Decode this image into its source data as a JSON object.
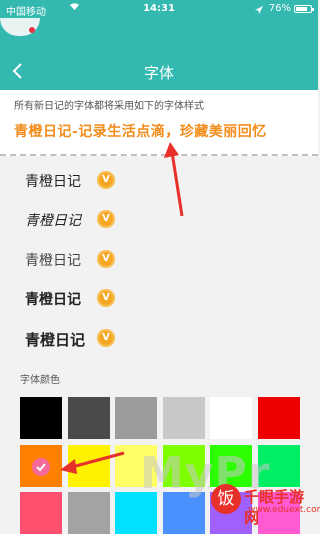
{
  "status_bar": {
    "carrier": "中国移动",
    "wifi_icon": "wifi-icon",
    "time": "14:31",
    "battery": "76%",
    "battery_level": 0.76
  },
  "header": {
    "title": "字体",
    "back_icon": "chevron-left-icon"
  },
  "preview": {
    "hint": "所有新日记的字体都将采用如下的字体样式",
    "sample": "青橙日记-记录生活点滴，珍藏美丽回忆"
  },
  "fonts": [
    {
      "name": "青橙日记",
      "badge": "V"
    },
    {
      "name": "青橙日记",
      "badge": "V"
    },
    {
      "name": "青橙日记",
      "badge": "V"
    },
    {
      "name": "青橙日记",
      "badge": "V"
    },
    {
      "name": "青橙日记",
      "badge": "V"
    }
  ],
  "color_section": {
    "label": "字体颜色",
    "colors": [
      "#000000",
      "#4a4a4a",
      "#9b9b9b",
      "#c8c8c8",
      "#ffffff",
      "#ee0000",
      "#ff8000",
      "#fff200",
      "#ffff66",
      "#7dff00",
      "#2bff00",
      "#00ee66",
      "#ff4e6e",
      "#a3a3a3",
      "#00e0ff",
      "#4a90ff",
      "#a060ff",
      "#ff5ad2"
    ],
    "selected_index": 6
  },
  "watermark": {
    "main": "MyPr",
    "logo_char": "饭",
    "site": "千眼手游网",
    "url": "www.eduext.com"
  }
}
